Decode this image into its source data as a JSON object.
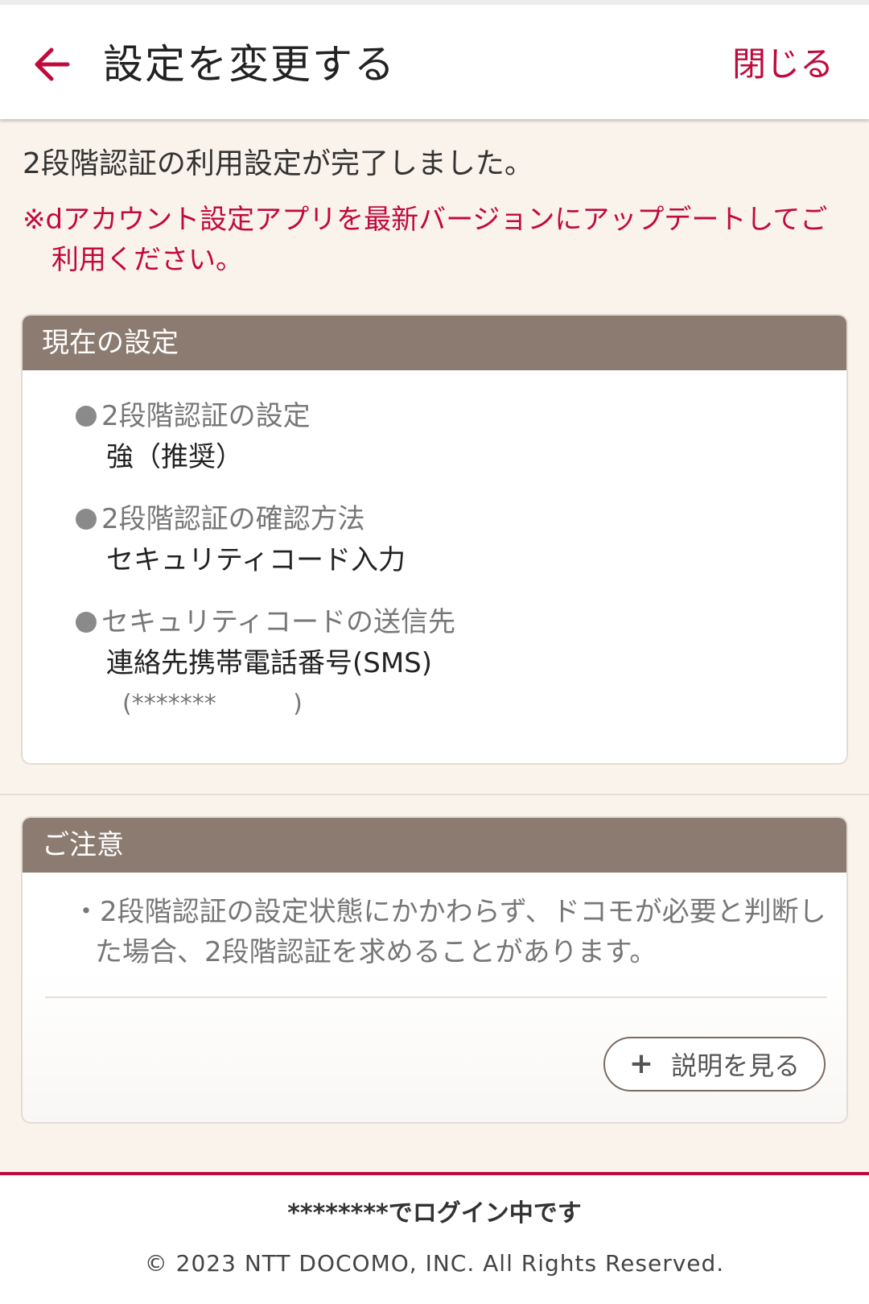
{
  "header": {
    "title": "設定を変更する",
    "close_label": "閉じる"
  },
  "main": {
    "completion_message": "2段階認証の利用設定が完了しました。",
    "notice_message": "※dアカウント設定アプリを最新バージョンにアップデートしてご利用ください。"
  },
  "current_settings": {
    "header": "現在の設定",
    "items": [
      {
        "label": "2段階認証の設定",
        "value": "強（推奨）"
      },
      {
        "label": "2段階認証の確認方法",
        "value": "セキュリティコード入力"
      },
      {
        "label": "セキュリティコードの送信先",
        "value": "連絡先携帯電話番号(SMS)",
        "sub": "(*******          )"
      }
    ]
  },
  "caution": {
    "header": "ご注意",
    "text": "・2段階認証の設定状態にかかわらず、ドコモが必要と判断した場合、2段階認証を求めることがあります。",
    "explain_button": "説明を見る"
  },
  "footer": {
    "login_status": "********でログイン中です",
    "copyright": "© 2023 NTT DOCOMO, INC. All Rights Reserved."
  },
  "colors": {
    "accent": "#c10a3c",
    "card_header": "#8c7b70",
    "background": "#faf3ec"
  },
  "icons": {
    "back": "arrow-left-icon",
    "plus": "plus-icon",
    "bullet": "bullet-dot-icon"
  }
}
